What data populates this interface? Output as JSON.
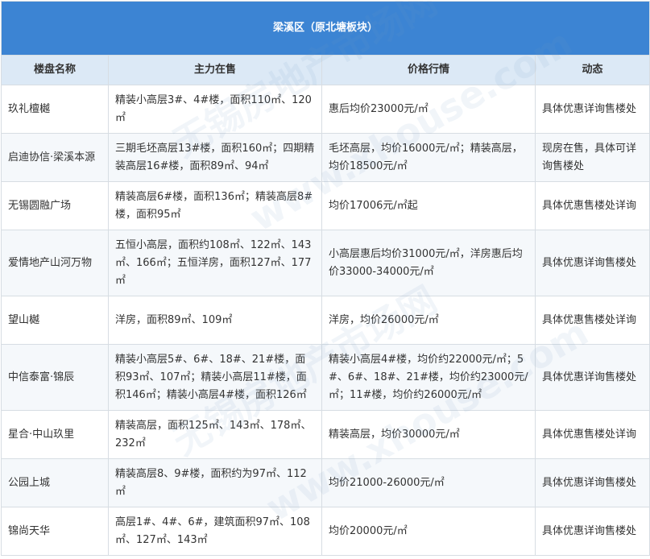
{
  "table": {
    "title": "梁溪区（原北塘板块）",
    "headers": [
      "楼盘名称",
      "主力在售",
      "价格行情",
      "动态"
    ],
    "rows": [
      {
        "name": "玖礼檀樾",
        "supply": "精装小高层3#、4#楼，面积110㎡、120㎡",
        "price": "惠后均价23000元/㎡",
        "status": "具体优惠详询售楼处"
      },
      {
        "name": "启迪协信·梁溪本源",
        "supply": "三期毛坯高层13#楼，面积160㎡；四期精装高层16#楼，面积89㎡、94㎡",
        "price": "毛坯高层，均价16000元/㎡；精装高层，均价18500元/㎡",
        "status": "现房在售，具体可详询售楼处"
      },
      {
        "name": "无锡圆融广场",
        "supply": "精装高层6#楼，面积136㎡；精装高层8#楼，面积95㎡",
        "price": "均价17006元/㎡起",
        "status": "具体优惠售楼处详询"
      },
      {
        "name": "爱情地产山河万物",
        "supply": "五恒小高层，面积约108㎡、122㎡、143㎡、166㎡；五恒洋房，面积127㎡、177㎡",
        "price": "小高层惠后均价31000元/㎡，洋房惠后均价33000-34000元/㎡",
        "status": "具体优惠详询售楼处"
      },
      {
        "name": "望山樾",
        "supply": "洋房，面积89㎡、109㎡",
        "price": "洋房，均价26000元/㎡",
        "status": "具体优惠售楼处详询"
      },
      {
        "name": "中信泰富·锦辰",
        "supply": "精装小高层5#、6#、18#、21#楼，面积93㎡、107㎡；精装小高层11#楼，面积146㎡；精装小高层4#楼，面积126㎡",
        "price": "精装小高层4#楼，均价约22000元/㎡；5#、6#、18#、21#楼，均价约23000元/㎡；11#楼，均价约26000元/㎡",
        "status": "具体优惠详询售楼处"
      },
      {
        "name": "星合·中山玖里",
        "supply": "精装高层，面积125㎡、143㎡、178㎡、232㎡",
        "price": "精装高层，均价30000元/㎡",
        "status": "具体优惠售楼处详询"
      },
      {
        "name": "公园上城",
        "supply": "精装高层8、9#楼，面积约为97㎡、112㎡",
        "price": "均价21000-26000元/㎡",
        "status": "具体优惠详询售楼处"
      },
      {
        "name": "锦尚天华",
        "supply": "高层1#、4#、6#，建筑面积97㎡、108㎡、127㎡、143㎡",
        "price": "均价20000元/㎡",
        "status": "具体优惠详询售楼处"
      }
    ]
  },
  "watermark": {
    "text_cn": "无锡房地产市场网",
    "text_url": "www.xhouse.com"
  },
  "colors": {
    "title_bg": "#3c84d3",
    "header_bg": "#dce9f6",
    "border": "#d7dde3"
  }
}
